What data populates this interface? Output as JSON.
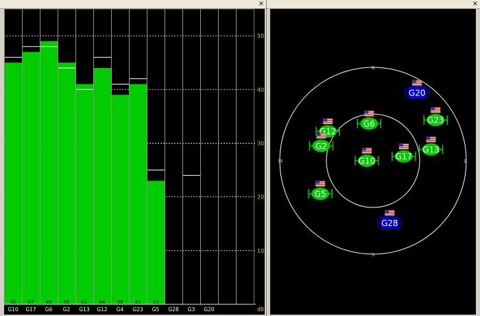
{
  "left_panel": {
    "close_label": "×"
  },
  "right_panel": {
    "close_label": "×"
  },
  "chart_data": {
    "type": "bar",
    "categories": [
      "G10",
      "G17",
      "G6",
      "G2",
      "G13",
      "G12",
      "G4",
      "G23",
      "G5",
      "G28",
      "G3",
      "G20"
    ],
    "series": [
      {
        "values": [
          45,
          47,
          49,
          45,
          41,
          44,
          39,
          41,
          23,
          null,
          null,
          null
        ]
      }
    ],
    "max_marks": [
      46,
      48,
      48,
      44,
      40,
      46,
      41,
      42,
      25,
      null,
      24,
      null
    ],
    "value_labels": [
      "45",
      "47",
      "49",
      "45",
      "41",
      "44",
      "39",
      "41",
      "23",
      "",
      "",
      ""
    ],
    "y_ticks": [
      "10",
      "20",
      "30",
      "40",
      "50"
    ],
    "y_unit": "dB",
    "ylim": [
      0,
      55
    ],
    "grid": true,
    "colors": {
      "bar": "#00cc00",
      "background": "#000000",
      "grid": "#ffffff",
      "text": "#ffffff"
    }
  },
  "sky": {
    "directions": {
      "n": "N",
      "s": "S",
      "e": "E",
      "w": "W"
    },
    "satellites": [
      {
        "id": "G20",
        "azimuth": 33,
        "elevation": 12,
        "used": false
      },
      {
        "id": "G12",
        "azimuth": 303,
        "elevation": 38,
        "used": true
      },
      {
        "id": "G6",
        "azimuth": 354,
        "elevation": 54,
        "used": true
      },
      {
        "id": "G23",
        "azimuth": 57,
        "elevation": 18,
        "used": true
      },
      {
        "id": "G2",
        "azimuth": 286,
        "elevation": 38,
        "used": true
      },
      {
        "id": "G17",
        "azimuth": 82,
        "elevation": 60,
        "used": true
      },
      {
        "id": "G13",
        "azimuth": 79,
        "elevation": 33,
        "used": true
      },
      {
        "id": "G10",
        "azimuth": 270,
        "elevation": 84,
        "used": true
      },
      {
        "id": "G5",
        "azimuth": 238,
        "elevation": 30,
        "used": true
      },
      {
        "id": "G28",
        "azimuth": 165,
        "elevation": 28,
        "used": false
      }
    ],
    "colors": {
      "used": "#00cc00",
      "unused": "#0000cc",
      "ring": "#ffffff",
      "background": "#000000"
    }
  }
}
